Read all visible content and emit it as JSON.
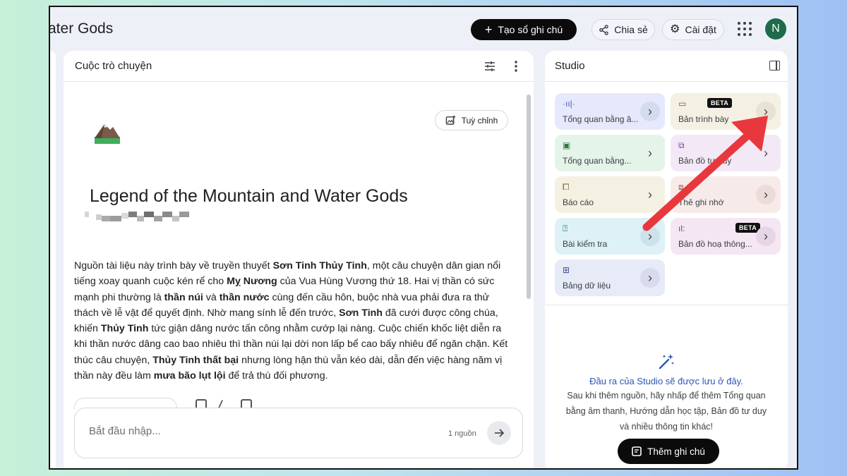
{
  "header": {
    "title": "ater Gods",
    "create_notebook_label": "Tạo sổ ghi chú",
    "share_label": "Chia sẻ",
    "settings_label": "Cài đặt",
    "avatar_initial": "N"
  },
  "chat": {
    "panel_title": "Cuộc trò chuyện",
    "customize_label": "Tuỳ chỉnh",
    "document_title": "Legend of the Mountain and Water Gods",
    "summary": [
      {
        "t": "Nguồn tài liệu này trình bày về truyền thuyết "
      },
      {
        "t": "Sơn Tinh Thủy Tinh",
        "b": true
      },
      {
        "t": ", một câu chuyện dân gian nổi tiếng xoay quanh cuộc kén rể cho "
      },
      {
        "t": "Mỵ Nương",
        "b": true
      },
      {
        "t": " của Vua Hùng Vương thứ 18. Hai vị thần có sức mạnh phi thường là "
      },
      {
        "t": "thần núi",
        "b": true
      },
      {
        "t": " và "
      },
      {
        "t": "thần nước",
        "b": true
      },
      {
        "t": " cùng đến cầu hôn, buộc nhà vua phải đưa ra thử thách về lễ vật để quyết định. Nhờ mang sính lễ đến trước, "
      },
      {
        "t": "Sơn Tinh",
        "b": true
      },
      {
        "t": " đã cưới được công chúa, khiến "
      },
      {
        "t": "Thủy Tinh",
        "b": true
      },
      {
        "t": " tức giận dâng nước tấn công nhằm cướp lại nàng. Cuộc chiến khốc liệt diễn ra khi thần nước dâng cao bao nhiêu thì thần núi lại dời non lấp bể cao bấy nhiêu để ngăn chặn. Kết thúc câu chuyện, "
      },
      {
        "t": "Thủy Tinh thất bại",
        "b": true
      },
      {
        "t": " nhưng lòng hận thù vẫn kéo dài, dẫn đến việc hàng năm vị thần này đều làm "
      },
      {
        "t": "mưa bão lụt lội",
        "b": true
      },
      {
        "t": " để trả thù đối phương."
      }
    ],
    "input_placeholder": "Bắt đầu nhập...",
    "source_count": "1 nguồn"
  },
  "studio": {
    "panel_title": "Studio",
    "tiles": [
      {
        "label": "Tổng quan bằng â...",
        "icon": "audio-waveform-icon",
        "glyph": "·ıı|·",
        "bg": "#e5e9fb",
        "arrow_bg": "#d5dbef",
        "icon_color": "#4a5ab0",
        "beta": false
      },
      {
        "label": "Bản trình bày",
        "icon": "slides-icon",
        "glyph": "▭",
        "bg": "#f4f0e4",
        "arrow_bg": "#e6e2d5",
        "icon_color": "#6d5d2a",
        "beta": true
      },
      {
        "label": "Tổng quan bằng...",
        "icon": "video-icon",
        "glyph": "▣",
        "bg": "#e4f4e8",
        "arrow_bg": "#e4f4e8",
        "icon_color": "#2c7a45",
        "beta": false
      },
      {
        "label": "Bản đồ tư duy",
        "icon": "mindmap-icon",
        "glyph": "⧉",
        "bg": "#f3e9f6",
        "arrow_bg": "#f3e9f6",
        "icon_color": "#7a3f8e",
        "beta": false
      },
      {
        "label": "Báo cáo",
        "icon": "report-icon",
        "glyph": "⧠",
        "bg": "#f4f1e2",
        "arrow_bg": "#f4f1e2",
        "icon_color": "#6d5d2a",
        "beta": false
      },
      {
        "label": "Thẻ ghi nhớ",
        "icon": "flashcard-icon",
        "glyph": "⧈",
        "bg": "#f7ebe9",
        "arrow_bg": "#ecdcd9",
        "icon_color": "#9a4b3d",
        "beta": false
      },
      {
        "label": "Bài kiểm tra",
        "icon": "quiz-icon",
        "glyph": "⍰",
        "bg": "#def1f7",
        "arrow_bg": "#cde2ea",
        "icon_color": "#1f6f86",
        "beta": false
      },
      {
        "label": "Bản đồ hoạ thông...",
        "icon": "infographic-icon",
        "glyph": "ıl:",
        "bg": "#f4e7f3",
        "arrow_bg": "#e6d6e5",
        "icon_color": "#8a3a80",
        "beta": true
      },
      {
        "label": "Bảng dữ liệu",
        "icon": "table-icon",
        "glyph": "⊞",
        "bg": "#e7eaf7",
        "arrow_bg": "#d7dbeb",
        "icon_color": "#3f4d8f",
        "beta": false
      }
    ],
    "beta_label": "BETA",
    "empty_heading": "Đầu ra của Studio sẽ được lưu ở đây.",
    "empty_desc": "Sau khi thêm nguồn, hãy nhấp để thêm Tổng quan bằng âm thanh, Hướng dẫn học tập, Bản đồ tư duy và nhiều thông tin khác!",
    "add_note_label": "Thêm ghi chú"
  },
  "colors": {
    "accent_dark": "#0b0b0b",
    "annotation_arrow": "#e8383d",
    "empty_heading": "#2b55b8"
  }
}
